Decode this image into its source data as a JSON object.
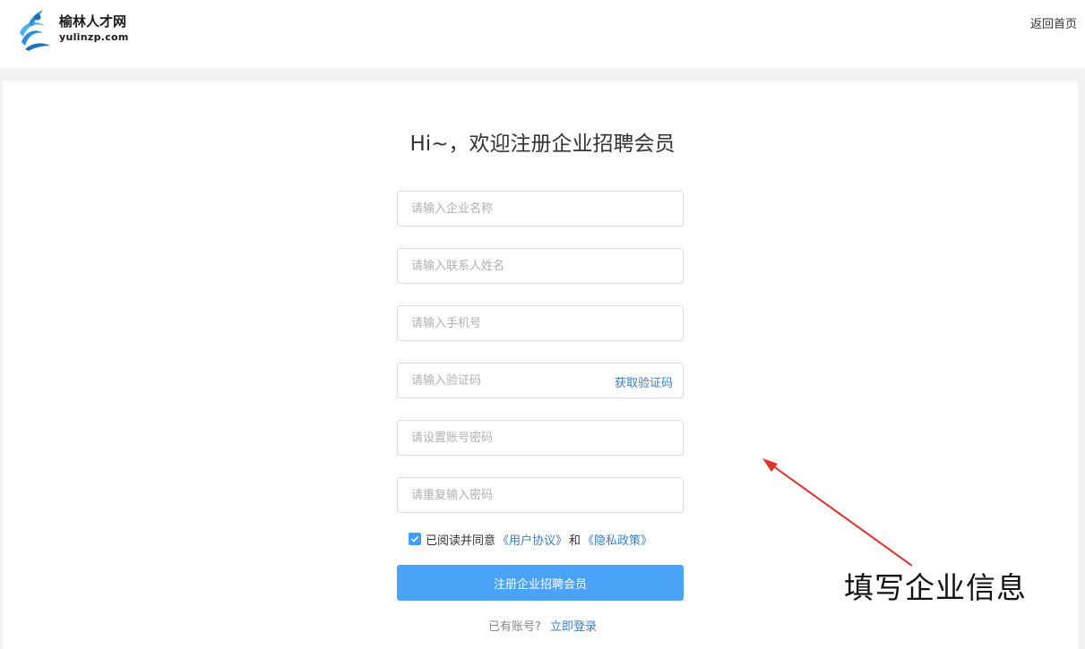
{
  "header": {
    "logo_cn": "榆林人才网",
    "logo_en": "yulinzp.com",
    "home_link": "返回首页"
  },
  "form": {
    "title": "Hi~，欢迎注册企业招聘会员",
    "company_placeholder": "请输入企业名称",
    "contact_placeholder": "请输入联系人姓名",
    "phone_placeholder": "请输入手机号",
    "code_placeholder": "请输入验证码",
    "get_code_label": "获取验证码",
    "password_placeholder": "请设置账号密码",
    "confirm_password_placeholder": "请重复输入密码",
    "agree_text": "已阅读并同意",
    "user_agreement": "《用户协议》",
    "and_text": "和",
    "privacy_policy": "《隐私政策》",
    "agree_checked": true,
    "submit_label": "注册企业招聘会员",
    "have_account_text": "已有账号?",
    "login_link": "立即登录"
  },
  "annotation": {
    "text": "填写企业信息"
  },
  "colors": {
    "accent": "#4aa3f8",
    "link": "#3b7fc4",
    "annotation_arrow": "#e0312b"
  }
}
